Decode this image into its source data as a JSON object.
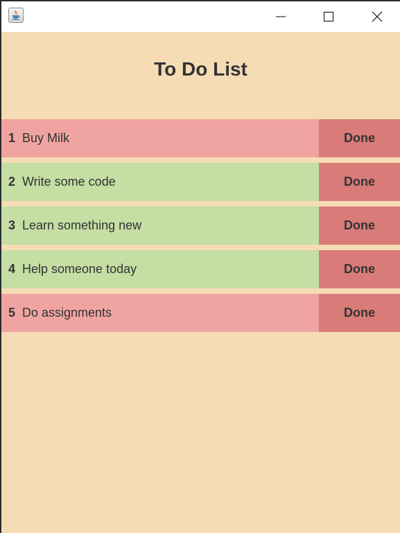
{
  "header": {
    "title": "To Do List"
  },
  "window_controls": {
    "icons": [
      "java-cup-icon",
      "minimize-icon",
      "maximize-icon",
      "close-icon"
    ]
  },
  "colors": {
    "background": "#f5dcb4",
    "pending_row": "#f0a4a1",
    "done_row": "#c4dea4",
    "done_button": "#d97b78",
    "text": "#333333"
  },
  "todos": [
    {
      "number": "1",
      "text": "Buy Milk",
      "button_label": "Done",
      "status": "pending"
    },
    {
      "number": "2",
      "text": "Write some code",
      "button_label": "Done",
      "status": "done"
    },
    {
      "number": "3",
      "text": "Learn something new",
      "button_label": "Done",
      "status": "done"
    },
    {
      "number": "4",
      "text": "Help someone today",
      "button_label": "Done",
      "status": "done"
    },
    {
      "number": "5",
      "text": "Do assignments",
      "button_label": "Done",
      "status": "pending"
    }
  ]
}
